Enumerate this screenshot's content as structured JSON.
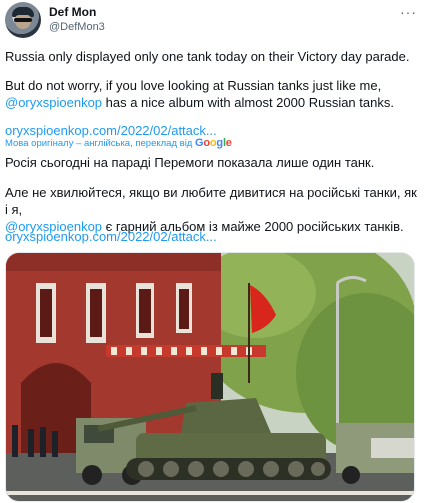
{
  "tweet": {
    "author_name": "Def Mon",
    "author_handle": "@DefMon3",
    "more_icon": "···",
    "original": {
      "line1": "Russia only displayed only one tank today on their Victory day parade.",
      "line2_part1": "But do not worry, if you love looking at Russian tanks just like me,",
      "mention": "@oryxspioenkop",
      "line2_part2": " has a nice album with almost 2000 Russian tanks.",
      "link": "oryxspioenkop.com/2022/02/attack..."
    },
    "translation_note": "Мова оригіналу – англійська, переклад від",
    "translation_provider": [
      "G",
      "o",
      "o",
      "g",
      "l",
      "e"
    ],
    "translated": {
      "line1": "Росія сьогодні на параді Перемоги показала лише один танк.",
      "line2_part1": "Але не хвилюйтеся, якщо ви любите дивитися на російські танки, як і я,",
      "mention": "@oryxspioenkop",
      "line2_part2": " є гарний альбом із майже 2000 російських танків.",
      "link": "oryxspioenkop.com/2022/02/attack..."
    }
  },
  "colors": {
    "link": "#1d9bf0",
    "text": "#0f1419",
    "secondary": "#536471"
  }
}
